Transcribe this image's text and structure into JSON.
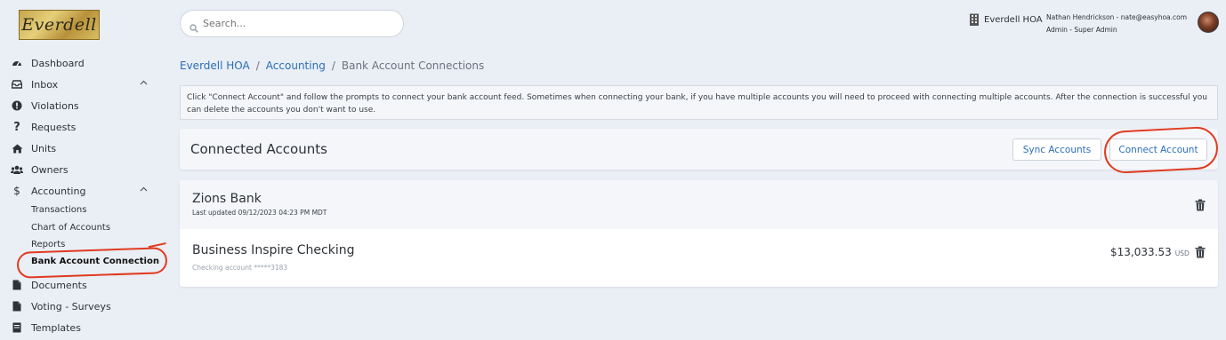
{
  "app": {
    "logo_text": "Everdell"
  },
  "search": {
    "placeholder": "Search..."
  },
  "header": {
    "org_name": "Everdell HOA",
    "user_line": "Nathan Hendrickson - nate@easyhoa.com",
    "role_line": "Admin - Super Admin"
  },
  "sidebar": {
    "items": [
      {
        "label": "Dashboard",
        "icon": "dashboard-icon"
      },
      {
        "label": "Inbox",
        "icon": "inbox-icon",
        "expandable": true
      },
      {
        "label": "Violations",
        "icon": "alert-circle-icon"
      },
      {
        "label": "Requests",
        "icon": "question-icon"
      },
      {
        "label": "Units",
        "icon": "home-icon"
      },
      {
        "label": "Owners",
        "icon": "users-icon"
      },
      {
        "label": "Accounting",
        "icon": "dollar-icon",
        "expandable": true,
        "expanded": true
      },
      {
        "label": "Documents",
        "icon": "document-icon"
      },
      {
        "label": "Voting - Surveys",
        "icon": "document-icon"
      },
      {
        "label": "Templates",
        "icon": "document-icon"
      }
    ],
    "accounting_sub": [
      {
        "label": "Transactions"
      },
      {
        "label": "Chart of Accounts"
      },
      {
        "label": "Reports"
      },
      {
        "label": "Bank Account Connection",
        "active": true
      }
    ]
  },
  "breadcrumb": {
    "home": "Everdell HOA",
    "section": "Accounting",
    "current": "Bank Account Connections",
    "separator": "/"
  },
  "info_text": "Click \"Connect Account\" and follow the prompts to connect your bank account feed. Sometimes when connecting your bank, if you have multiple accounts you will need to proceed with connecting multiple accounts. After the connection is successful you can delete the accounts you don't want to use.",
  "connected": {
    "title": "Connected Accounts",
    "sync_label": "Sync Accounts",
    "connect_label": "Connect Account"
  },
  "bank": {
    "name": "Zions Bank",
    "updated": "Last updated 09/12/2023 04:23 PM MDT",
    "account": {
      "name": "Business Inspire Checking",
      "number": "Checking account *****3183",
      "balance": "$13,033.53",
      "currency": "USD"
    }
  },
  "colors": {
    "link": "#2a6fb8",
    "annotation": "#e03a1f",
    "background": "#eaeef5"
  }
}
